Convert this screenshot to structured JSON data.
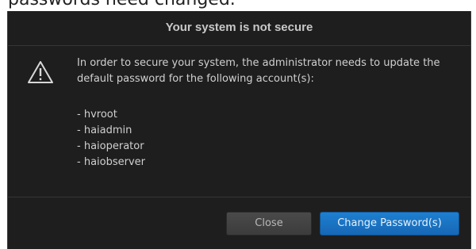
{
  "page": {
    "heading_fragment": "passwords need changed."
  },
  "dialog": {
    "title": "Your system is not secure",
    "icon": "warning-triangle-icon",
    "message": "In order to secure your system, the administrator needs to update the default password for the following account(s):",
    "accounts": [
      "- hvroot",
      "- haiadmin",
      "- haioperator",
      "- haiobserver"
    ],
    "buttons": {
      "close_label": "Close",
      "change_password_label": "Change Password(s)"
    },
    "colors": {
      "background": "#1e1e1e",
      "primary_button": "#1a74c4",
      "secondary_button": "#444444",
      "text": "#d0d0d0"
    }
  }
}
